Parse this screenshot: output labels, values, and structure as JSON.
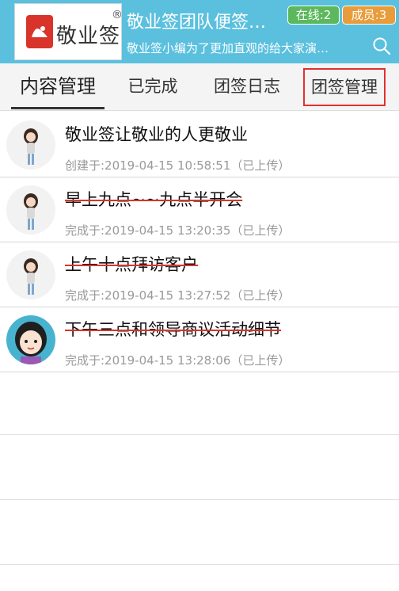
{
  "header": {
    "logo_text": "敬业签",
    "logo_reg": "®",
    "title": "敬业签团队便签…",
    "subtitle": "敬业签小编为了更加直观的给大家演…",
    "online_badge": "在线:2",
    "members_badge": "成员:3",
    "search_icon": "search-icon"
  },
  "tabs": [
    {
      "label": "内容管理",
      "active": true
    },
    {
      "label": "已完成",
      "active": false
    },
    {
      "label": "团签日志",
      "active": false
    },
    {
      "label": "团签管理",
      "active": false,
      "highlighted": true
    }
  ],
  "tasks": [
    {
      "title": "敬业签让敬业的人更敬业",
      "meta": "创建于:2019-04-15 10:58:51（已上传）",
      "completed": false,
      "avatar": "girl-avatar"
    },
    {
      "title": "早上九点~~九点半开会",
      "meta": "完成于:2019-04-15 13:20:35（已上传）",
      "completed": true,
      "avatar": "girl-avatar"
    },
    {
      "title": "上午十点拜访客户",
      "meta": "完成于:2019-04-15 13:27:52（已上传）",
      "completed": true,
      "avatar": "girl-avatar"
    },
    {
      "title": "下午三点和领导商议活动细节",
      "meta": "完成于:2019-04-15 13:28:06（已上传）",
      "completed": true,
      "avatar": "cartoon-girl-avatar"
    }
  ],
  "colors": {
    "header_bg": "#5bc0de",
    "online_badge": "#5cb85c",
    "members_badge": "#e89c3b",
    "strike": "#d9342b",
    "highlight_border": "#e03030"
  }
}
